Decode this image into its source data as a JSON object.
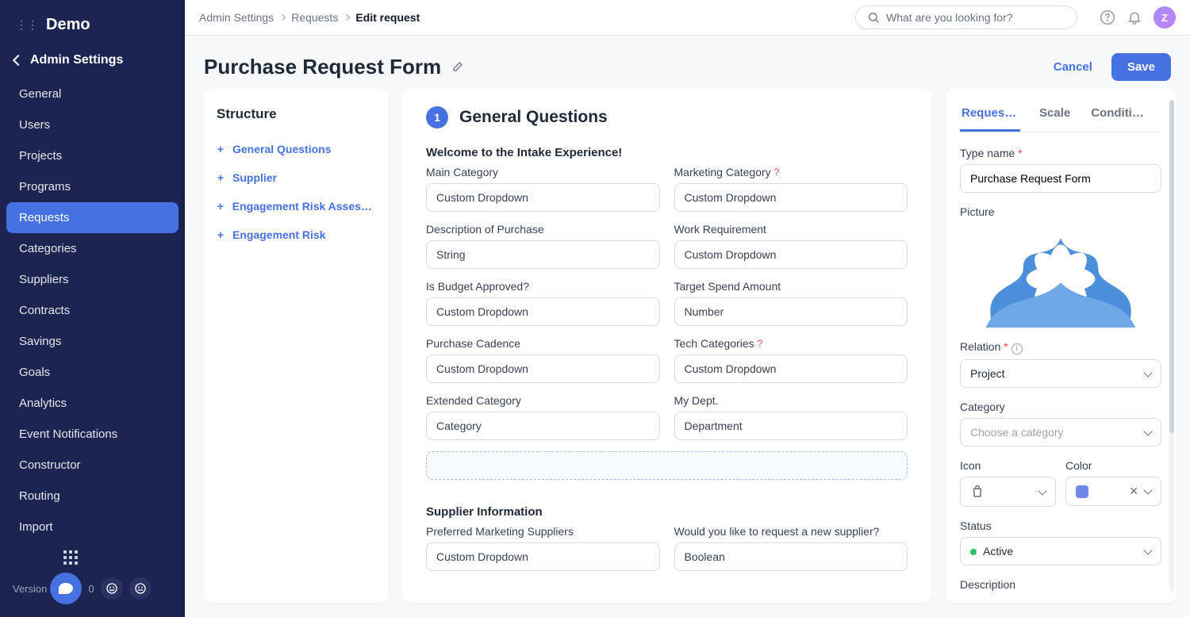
{
  "brand": "Demo",
  "sidebar": {
    "header": "Admin Settings",
    "items": [
      {
        "label": "General"
      },
      {
        "label": "Users"
      },
      {
        "label": "Projects"
      },
      {
        "label": "Programs"
      },
      {
        "label": "Requests"
      },
      {
        "label": "Categories"
      },
      {
        "label": "Suppliers"
      },
      {
        "label": "Contracts"
      },
      {
        "label": "Savings"
      },
      {
        "label": "Goals"
      },
      {
        "label": "Analytics"
      },
      {
        "label": "Event Notifications"
      },
      {
        "label": "Constructor"
      },
      {
        "label": "Routing"
      },
      {
        "label": "Import"
      }
    ],
    "version_label": "Version"
  },
  "breadcrumbs": {
    "a": "Admin Settings",
    "b": "Requests",
    "c": "Edit request"
  },
  "search": {
    "placeholder": "What are you looking for?"
  },
  "avatar_initial": "Z",
  "page_title": "Purchase Request Form",
  "actions": {
    "cancel": "Cancel",
    "save": "Save"
  },
  "structure": {
    "title": "Structure",
    "items": [
      {
        "label": "General Questions"
      },
      {
        "label": "Supplier"
      },
      {
        "label": "Engagement Risk Assess…"
      },
      {
        "label": "Engagement Risk"
      }
    ]
  },
  "editor": {
    "section_number": "1",
    "section_title": "General Questions",
    "subsection_welcome": "Welcome to the Intake Experience!",
    "fields1": [
      {
        "label": "Main Category",
        "value": "Custom Dropdown"
      },
      {
        "label": "Marketing Category",
        "value": "Custom Dropdown",
        "help": "?"
      },
      {
        "label": "Description of Purchase",
        "value": "String"
      },
      {
        "label": "Work Requirement",
        "value": "Custom Dropdown"
      },
      {
        "label": "Is Budget Approved?",
        "value": "Custom Dropdown"
      },
      {
        "label": "Target Spend Amount",
        "value": "Number"
      },
      {
        "label": "Purchase Cadence",
        "value": "Custom Dropdown"
      },
      {
        "label": "Tech Categories",
        "value": "Custom Dropdown",
        "help": "?"
      },
      {
        "label": "Extended Category",
        "value": "Category"
      },
      {
        "label": "My Dept.",
        "value": "Department"
      }
    ],
    "subsection_supplier": "Supplier Information",
    "fields2": [
      {
        "label": "Preferred Marketing Suppliers",
        "value": "Custom Dropdown"
      },
      {
        "label": "Would you like to request a new supplier?",
        "value": "Boolean"
      }
    ]
  },
  "details": {
    "tabs": {
      "t1": "Request settings",
      "t2": "Scale",
      "t3": "Conditions"
    },
    "type_name_label": "Type name",
    "type_name_value": "Purchase Request Form",
    "picture_label": "Picture",
    "relation_label": "Relation",
    "relation_value": "Project",
    "category_label": "Category",
    "category_placeholder": "Choose a category",
    "icon_label": "Icon",
    "color_label": "Color",
    "status_label": "Status",
    "status_value": "Active",
    "description_label": "Description"
  }
}
